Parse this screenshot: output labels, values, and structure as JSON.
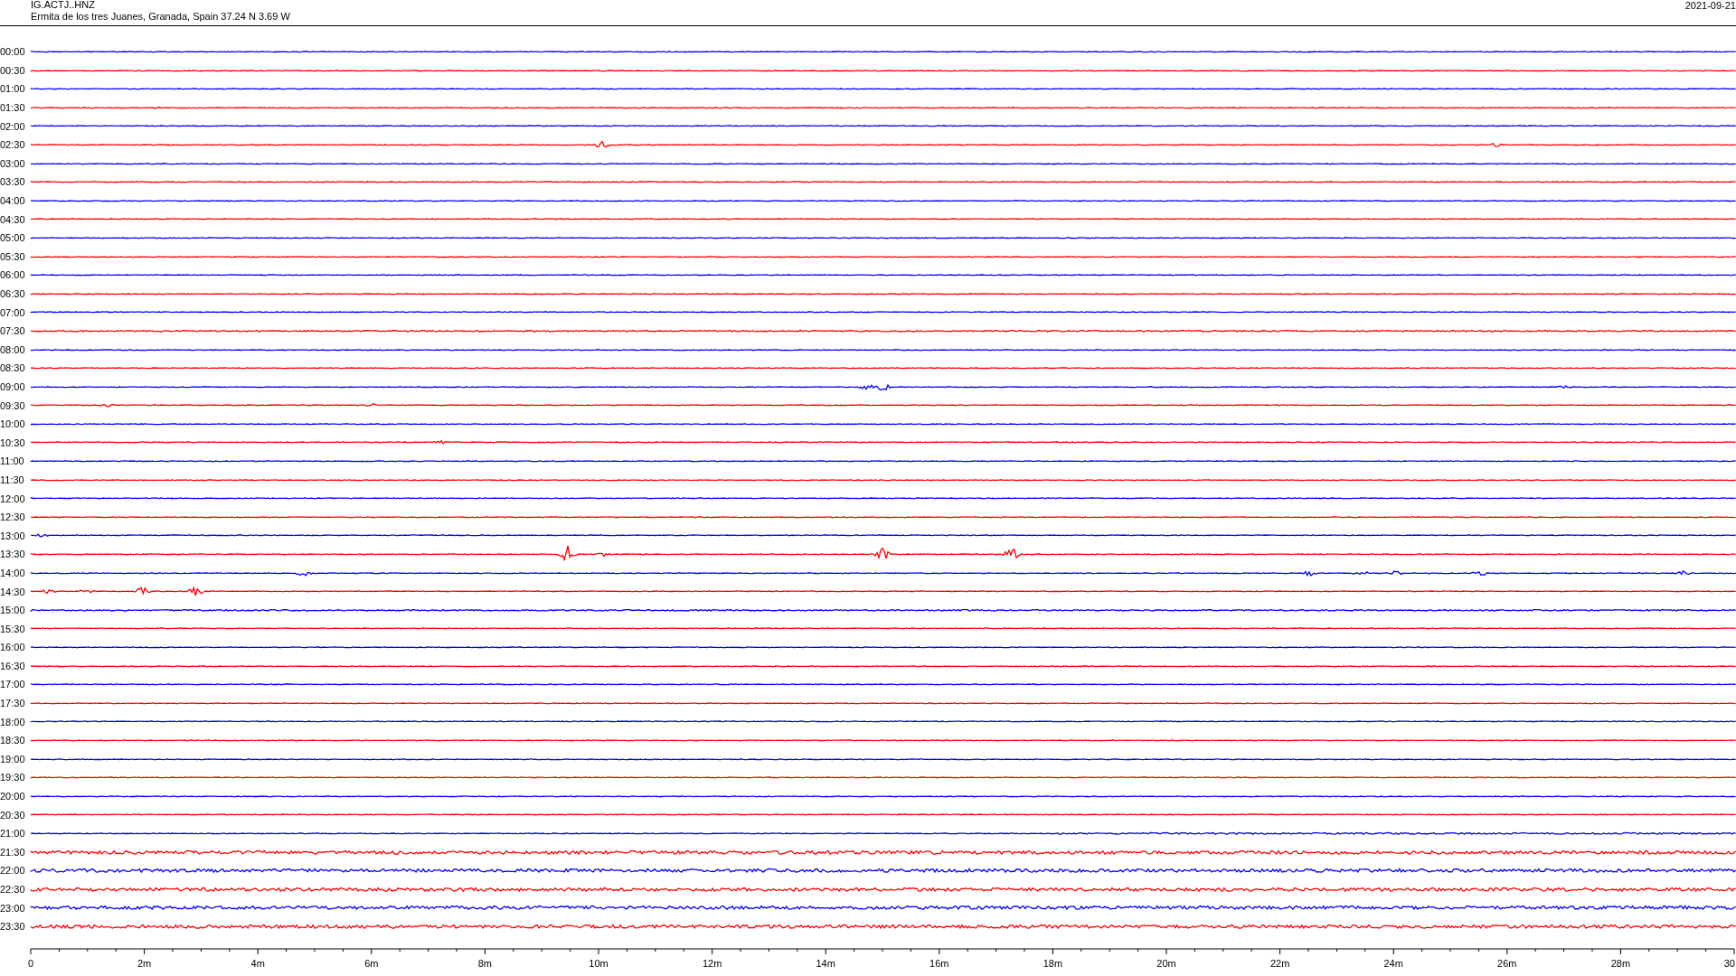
{
  "header": {
    "station": "IG.ACTJ..HNZ",
    "location": "Ermita de los tres Juanes, Granada, Spain  37.24 N 3.69 W",
    "date": "2021-09-21"
  },
  "traces": [
    {
      "label": "00:00",
      "color": "#0000ff"
    },
    {
      "label": "00:30",
      "color": "#ff0000"
    },
    {
      "label": "01:00",
      "color": "#0000ff"
    },
    {
      "label": "01:30",
      "color": "#ff0000"
    },
    {
      "label": "02:00",
      "color": "#0000ff"
    },
    {
      "label": "02:30",
      "color": "#ff0000"
    },
    {
      "label": "03:00",
      "color": "#0000ff"
    },
    {
      "label": "03:30",
      "color": "#ff0000"
    },
    {
      "label": "04:00",
      "color": "#0000ff"
    },
    {
      "label": "04:30",
      "color": "#ff0000"
    },
    {
      "label": "05:00",
      "color": "#0000ff"
    },
    {
      "label": "05:30",
      "color": "#ff0000"
    },
    {
      "label": "06:00",
      "color": "#0000ff"
    },
    {
      "label": "06:30",
      "color": "#ff0000"
    },
    {
      "label": "07:00",
      "color": "#0000ff"
    },
    {
      "label": "07:30",
      "color": "#ff0000"
    },
    {
      "label": "08:00",
      "color": "#0000ff"
    },
    {
      "label": "08:30",
      "color": "#ff0000"
    },
    {
      "label": "09:00",
      "color": "#0000ff"
    },
    {
      "label": "09:30",
      "color": "#ff0000"
    },
    {
      "label": "10:00",
      "color": "#0000ff"
    },
    {
      "label": "10:30",
      "color": "#ff0000"
    },
    {
      "label": "11:00",
      "color": "#0000ff"
    },
    {
      "label": "11:30",
      "color": "#ff0000"
    },
    {
      "label": "12:00",
      "color": "#0000ff"
    },
    {
      "label": "12:30",
      "color": "#ff0000"
    },
    {
      "label": "13:00",
      "color": "#0000ff"
    },
    {
      "label": "13:30",
      "color": "#ff0000"
    },
    {
      "label": "14:00",
      "color": "#0000ff"
    },
    {
      "label": "14:30",
      "color": "#ff0000"
    },
    {
      "label": "15:00",
      "color": "#0000ff"
    },
    {
      "label": "15:30",
      "color": "#ff0000"
    },
    {
      "label": "16:00",
      "color": "#0000ff"
    },
    {
      "label": "16:30",
      "color": "#ff0000"
    },
    {
      "label": "17:00",
      "color": "#0000ff"
    },
    {
      "label": "17:30",
      "color": "#ff0000"
    },
    {
      "label": "18:00",
      "color": "#0000ff"
    },
    {
      "label": "18:30",
      "color": "#ff0000"
    },
    {
      "label": "19:00",
      "color": "#0000ff"
    },
    {
      "label": "19:30",
      "color": "#ff0000"
    },
    {
      "label": "20:00",
      "color": "#0000ff"
    },
    {
      "label": "20:30",
      "color": "#ff0000"
    },
    {
      "label": "21:00",
      "color": "#0000ff"
    },
    {
      "label": "21:30",
      "color": "#ff0000"
    },
    {
      "label": "22:00",
      "color": "#0000ff"
    },
    {
      "label": "22:30",
      "color": "#ff0000"
    },
    {
      "label": "23:00",
      "color": "#0000ff"
    },
    {
      "label": "23:30",
      "color": "#ff0000"
    }
  ],
  "x_axis": {
    "ticks": [
      "0",
      "2m",
      "4m",
      "6m",
      "8m",
      "10m",
      "12m",
      "14m",
      "16m",
      "18m",
      "20m",
      "22m",
      "24m",
      "26m",
      "28m",
      "30"
    ]
  }
}
